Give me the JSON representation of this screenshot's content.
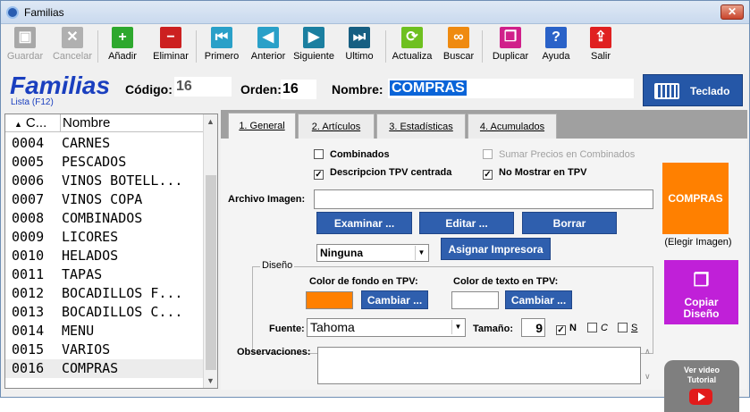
{
  "window": {
    "title": "Familias",
    "close_glyph": "✕"
  },
  "toolbar": {
    "buttons": [
      {
        "label": "Guardar",
        "icon": "save-icon",
        "color": "#a8a8a8",
        "glyph": "▣",
        "enabled": false
      },
      {
        "label": "Cancelar",
        "icon": "cancel-icon",
        "color": "#b0b0b0",
        "glyph": "✕",
        "enabled": false
      },
      {
        "label": "Añadir",
        "icon": "plus-icon",
        "color": "#2ea82e",
        "glyph": "+",
        "enabled": true
      },
      {
        "label": "Eliminar",
        "icon": "minus-icon",
        "color": "#cc2020",
        "glyph": "−",
        "enabled": true
      },
      {
        "label": "Primero",
        "icon": "first-icon",
        "color": "#2aa0c8",
        "glyph": "⏮",
        "enabled": true
      },
      {
        "label": "Anterior",
        "icon": "previous-icon",
        "color": "#2aa0c8",
        "glyph": "◀",
        "enabled": true
      },
      {
        "label": "Siguiente",
        "icon": "next-icon",
        "color": "#1b7fa0",
        "glyph": "▶",
        "enabled": true
      },
      {
        "label": "Ultimo",
        "icon": "last-icon",
        "color": "#175f82",
        "glyph": "⏭",
        "enabled": true
      },
      {
        "label": "Actualiza",
        "icon": "refresh-icon",
        "color": "#6ec020",
        "glyph": "⟳",
        "enabled": true
      },
      {
        "label": "Buscar",
        "icon": "binoculars-icon",
        "color": "#ef8a10",
        "glyph": "∞",
        "enabled": true
      },
      {
        "label": "Duplicar",
        "icon": "duplicate-icon",
        "color": "#d0208a",
        "glyph": "❐",
        "enabled": true
      },
      {
        "label": "Ayuda",
        "icon": "help-icon",
        "color": "#2a62c8",
        "glyph": "?",
        "enabled": true
      },
      {
        "label": "Salir",
        "icon": "exit-icon",
        "color": "#e02020",
        "glyph": "⇪",
        "enabled": true
      }
    ]
  },
  "header": {
    "title": "Familias",
    "lista_link": "Lista (F12)",
    "codigo_label": "Código:",
    "codigo_value": "16",
    "orden_label": "Orden:",
    "orden_value": "16",
    "nombre_label": "Nombre:",
    "nombre_value": "COMPRAS",
    "teclado_label": "Teclado"
  },
  "list": {
    "col_code": "C...",
    "col_sort_glyph": "▲",
    "col_name": "Nombre",
    "rows": [
      {
        "code": "0004",
        "name": "CARNES"
      },
      {
        "code": "0005",
        "name": "PESCADOS"
      },
      {
        "code": "0006",
        "name": "VINOS BOTELL..."
      },
      {
        "code": "0007",
        "name": "VINOS COPA"
      },
      {
        "code": "0008",
        "name": "COMBINADOS"
      },
      {
        "code": "0009",
        "name": "LICORES"
      },
      {
        "code": "0010",
        "name": "HELADOS"
      },
      {
        "code": "0011",
        "name": "TAPAS"
      },
      {
        "code": "0012",
        "name": "BOCADILLOS F..."
      },
      {
        "code": "0013",
        "name": "BOCADILLOS C..."
      },
      {
        "code": "0014",
        "name": "MENU"
      },
      {
        "code": "0015",
        "name": "VARIOS"
      },
      {
        "code": "0016",
        "name": "COMPRAS"
      }
    ],
    "selected_index": 12
  },
  "tabs": [
    {
      "label": "1. General",
      "active": true
    },
    {
      "label": "2. Artículos",
      "active": false
    },
    {
      "label": "3. Estadísticas",
      "active": false
    },
    {
      "label": "4. Acumulados",
      "active": false
    }
  ],
  "general": {
    "combinados": {
      "label": "Combinados",
      "checked": false
    },
    "sumar_precios": {
      "label": "Sumar Precios en Combinados",
      "checked": false
    },
    "descripcion_centrada": {
      "label": "Descripcion TPV centrada",
      "checked": true
    },
    "no_mostrar": {
      "label": "No Mostrar en TPV",
      "checked": true
    },
    "archivo_imagen_label": "Archivo Imagen:",
    "archivo_imagen_value": "",
    "examinar_label": "Examinar ...",
    "editar_label": "Editar ...",
    "borrar_label": "Borrar",
    "impresora_value": "Ninguna",
    "asignar_impresora_label": "Asignar Impresora",
    "diseno_title": "Diseño",
    "color_fondo_label": "Color de fondo en TPV:",
    "color_fondo": "#ff8000",
    "color_texto_label": "Color de texto en TPV:",
    "color_texto": "#ffffff",
    "cambiar_label": "Cambiar ...",
    "fuente_label": "Fuente:",
    "fuente_value": "Tahoma",
    "tamano_label": "Tamaño:",
    "tamano_value": "9",
    "bold_letter": "N",
    "italic_letter": "C",
    "underline_letter": "S",
    "bold_checked": true,
    "italic_checked": false,
    "underline_checked": false,
    "observaciones_label": "Observaciones:",
    "preview_text": "COMPRAS",
    "elegir_diseno": "(Elegir Imagen)",
    "copiar_diseno": "Copiar Diseño",
    "video_label": "Ver video Tutorial"
  },
  "colors": {
    "accent_blue": "#2557a7",
    "title_blue": "#1a3fbf",
    "preview_orange": "#ff8000",
    "copy_purple": "#c020d8"
  }
}
